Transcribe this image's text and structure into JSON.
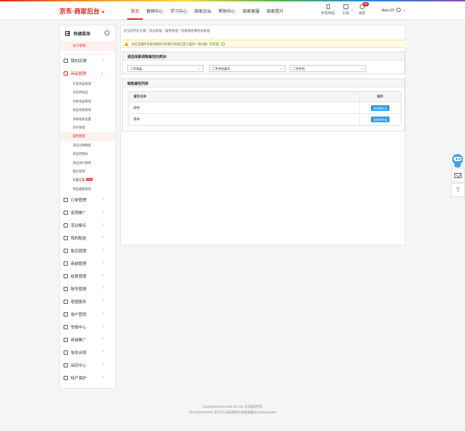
{
  "header": {
    "brand": "京东·商家后台",
    "nav": [
      "首页",
      "营销中心",
      "学习中心",
      "商家论坛",
      "帮助中心",
      "商家客服",
      "商家提升"
    ],
    "active_nav": 0,
    "tools": [
      {
        "label": "手机商后",
        "icon": "mobile-icon"
      },
      {
        "label": "工具",
        "icon": "toolbox-icon"
      },
      {
        "label": "消息",
        "icon": "message-icon",
        "badge": "99"
      }
    ],
    "username": "dayc10"
  },
  "sidebar": {
    "title": "快捷菜单",
    "shortcut": "员工管理",
    "groups_top": [
      {
        "label": "我的店铺",
        "icon": "store-icon"
      },
      {
        "label": "商品管理",
        "icon": "goods-icon",
        "open": true
      }
    ],
    "sub_items": [
      {
        "label": "在售商品管理"
      },
      {
        "label": "添加新商品"
      },
      {
        "label": "待售商品管理"
      },
      {
        "label": "商品资质管理"
      },
      {
        "label": "关联版式设置"
      },
      {
        "label": "库存管理"
      },
      {
        "label": "属性管理",
        "active": true
      },
      {
        "label": "商品详情模板"
      },
      {
        "label": "商品回收站"
      },
      {
        "label": "商品评价管理"
      },
      {
        "label": "图片管理"
      },
      {
        "label": "批量设置",
        "new": "NEW"
      },
      {
        "label": "特品模板管理"
      }
    ],
    "groups_bottom": [
      {
        "label": "订单管理",
        "icon": "order-icon"
      },
      {
        "label": "促销推广",
        "icon": "promo-icon"
      },
      {
        "label": "活动报名",
        "icon": "activity-icon"
      },
      {
        "label": "我的配送",
        "icon": "delivery-icon"
      },
      {
        "label": "售后管理",
        "icon": "aftersale-icon"
      },
      {
        "label": "商城管理",
        "icon": "mall-icon"
      },
      {
        "label": "结算管理",
        "icon": "settlement-icon"
      },
      {
        "label": "账号管理",
        "icon": "account-icon"
      },
      {
        "label": "增值服务",
        "icon": "service-icon"
      },
      {
        "label": "用户营销",
        "icon": "user-marketing-icon"
      },
      {
        "label": "举报中心",
        "icon": "report-icon"
      },
      {
        "label": "商城推广",
        "icon": "mall-promo-icon"
      },
      {
        "label": "信息合规",
        "icon": "compliance-icon"
      },
      {
        "label": "品控中心",
        "icon": "quality-icon"
      },
      {
        "label": "知产保护",
        "icon": "ip-icon"
      }
    ]
  },
  "main": {
    "breadcrumb": [
      "您当前所在位置",
      "商品管理",
      "属性管理",
      "商家销售属性值管理"
    ],
    "notice": {
      "text": "开启店铺所有类目颜色尺码属于商家自定义类目一致功能",
      "link": "已开启"
    },
    "category_card": {
      "title": "请选择要调整属性的类目:",
      "selects": [
        "二手商品",
        "二手手机通讯",
        "二手手机"
      ]
    },
    "attr_table": {
      "title": "销售属性列表",
      "col_name": "属性名称",
      "col_action": "操作",
      "rows": [
        {
          "name": "颜色",
          "action": "管理属性值"
        },
        {
          "name": "版本",
          "action": "管理属性值"
        }
      ]
    }
  },
  "footer": {
    "line1": "Copyright©2004-2016 JD.com 京东版权所有",
    "line2": "京ICP证070359号 北京市公安局朝阳分局备案编号110105014669"
  }
}
